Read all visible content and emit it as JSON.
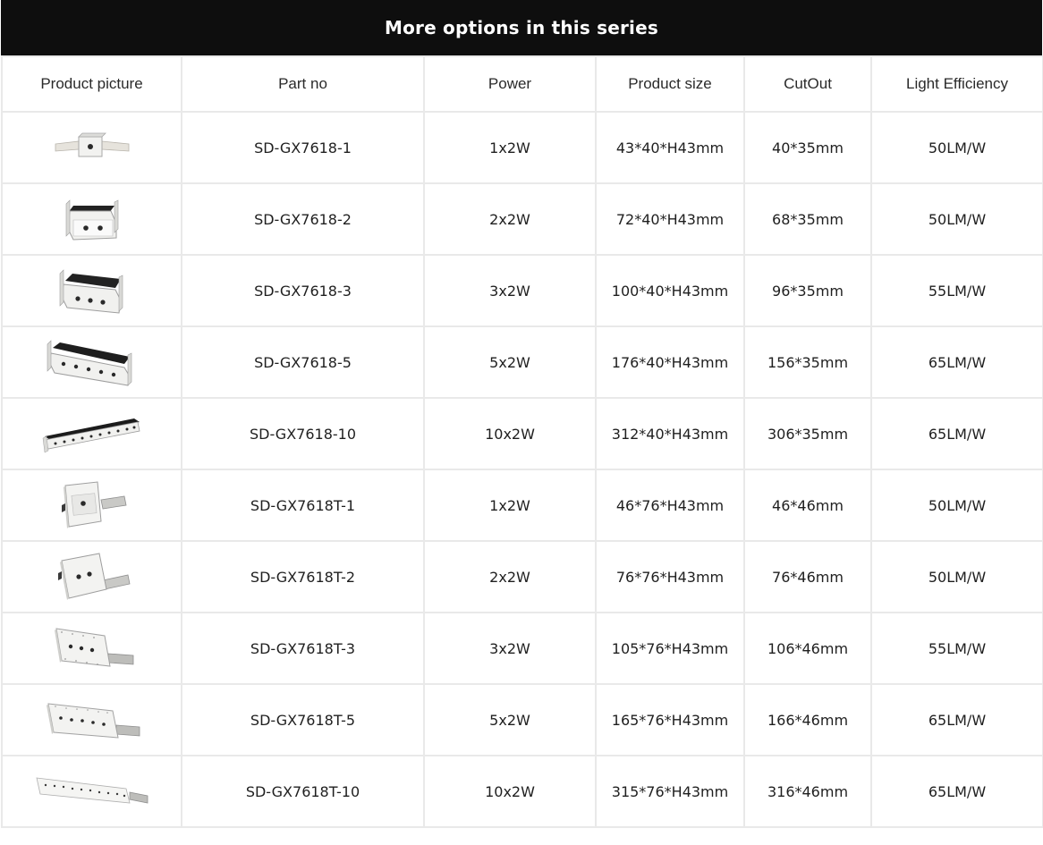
{
  "banner": {
    "title": "More options in this series"
  },
  "table": {
    "headers": [
      "Product picture",
      "Part no",
      "Power",
      "Product size",
      "CutOut",
      "Light Efficiency"
    ],
    "rows": [
      {
        "image": "product-image-1-head-strip",
        "part_no": "SD-GX7618-1",
        "power": "1x2W",
        "size": "43*40*H43mm",
        "cutout": "40*35mm",
        "efficiency": "50LM/W"
      },
      {
        "image": "product-image-2-head-strip",
        "part_no": "SD-GX7618-2",
        "power": "2x2W",
        "size": "72*40*H43mm",
        "cutout": "68*35mm",
        "efficiency": "50LM/W"
      },
      {
        "image": "product-image-3-head-strip",
        "part_no": "SD-GX7618-3",
        "power": "3x2W",
        "size": "100*40*H43mm",
        "cutout": "96*35mm",
        "efficiency": "55LM/W"
      },
      {
        "image": "product-image-5-head-strip",
        "part_no": "SD-GX7618-5",
        "power": "5x2W",
        "size": "176*40*H43mm",
        "cutout": "156*35mm",
        "efficiency": "65LM/W"
      },
      {
        "image": "product-image-10-head-strip",
        "part_no": "SD-GX7618-10",
        "power": "10x2W",
        "size": "312*40*H43mm",
        "cutout": "306*35mm",
        "efficiency": "65LM/W"
      },
      {
        "image": "product-image-1-head-trimless",
        "part_no": "SD-GX7618T-1",
        "power": "1x2W",
        "size": "46*76*H43mm",
        "cutout": "46*46mm",
        "efficiency": "50LM/W"
      },
      {
        "image": "product-image-2-head-trimless",
        "part_no": "SD-GX7618T-2",
        "power": "2x2W",
        "size": "76*76*H43mm",
        "cutout": "76*46mm",
        "efficiency": "50LM/W"
      },
      {
        "image": "product-image-3-head-trimless",
        "part_no": "SD-GX7618T-3",
        "power": "3x2W",
        "size": "105*76*H43mm",
        "cutout": "106*46mm",
        "efficiency": "55LM/W"
      },
      {
        "image": "product-image-5-head-trimless",
        "part_no": "SD-GX7618T-5",
        "power": "5x2W",
        "size": "165*76*H43mm",
        "cutout": "166*46mm",
        "efficiency": "65LM/W"
      },
      {
        "image": "product-image-10-head-trimless",
        "part_no": "SD-GX7618T-10",
        "power": "10x2W",
        "size": "315*76*H43mm",
        "cutout": "316*46mm",
        "efficiency": "65LM/W"
      }
    ]
  }
}
